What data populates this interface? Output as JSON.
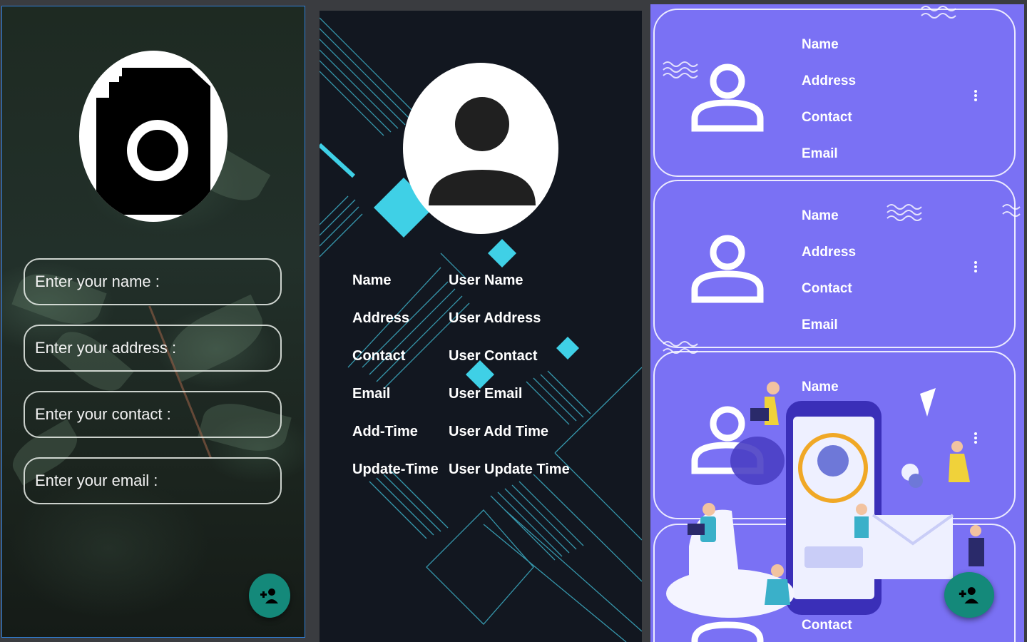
{
  "form": {
    "name_placeholder": "Enter your name :",
    "address_placeholder": "Enter your address :",
    "contact_placeholder": "Enter your contact :",
    "email_placeholder": "Enter your email :"
  },
  "details": {
    "rows": [
      {
        "label": "Name",
        "value": "User Name"
      },
      {
        "label": "Address",
        "value": "User Address"
      },
      {
        "label": "Contact",
        "value": "User Contact"
      },
      {
        "label": "Email",
        "value": "User Email"
      },
      {
        "label": "Add-Time",
        "value": "User Add Time"
      },
      {
        "label": "Update-Time",
        "value": "User Update Time"
      }
    ]
  },
  "list": {
    "field_labels": [
      "Name",
      "Address",
      "Contact",
      "Email"
    ]
  },
  "colors": {
    "fab": "#14897a",
    "list_bg": "#7a71f4",
    "details_bg": "#121720",
    "accent_cyan": "#3fd0e6"
  },
  "icons": {
    "camera": "camera-icon",
    "person": "person-icon",
    "add_user": "person-add-icon",
    "more": "more-vert-icon"
  }
}
